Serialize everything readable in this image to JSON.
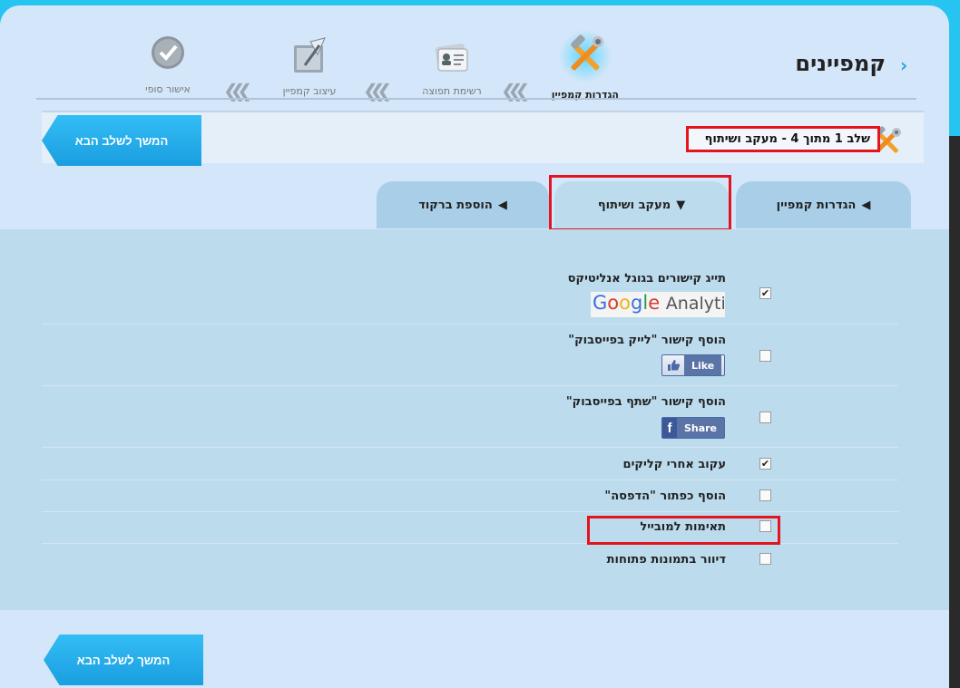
{
  "header": {
    "title": "קמפיינים"
  },
  "steps": [
    {
      "label": "הגדרות קמפיין",
      "icon": "tools-icon",
      "active": true
    },
    {
      "label": "רשימת תפוצה",
      "icon": "contacts-card-icon",
      "active": false
    },
    {
      "label": "עיצוב קמפיין",
      "icon": "design-pen-icon",
      "active": false
    },
    {
      "label": "אישור סופי",
      "icon": "checkmark-circle-icon",
      "active": false
    }
  ],
  "stepbar": {
    "info": "שלב 1 מתוך 4 - מעקב ושיתוף",
    "continue_label": "המשך לשלב הבא"
  },
  "tabs": [
    {
      "label": "הגדרות קמפיין",
      "state": "collapsed"
    },
    {
      "label": "מעקב ושיתוף",
      "state": "expanded"
    },
    {
      "label": "הוספת ברקוד",
      "state": "collapsed"
    }
  ],
  "options": [
    {
      "label": "תייג קישורים בגוגל אנליטיקס",
      "checked": true,
      "badge": "Google Analytics"
    },
    {
      "label": "הוסף קישור \"לייק בפייסבוק\"",
      "checked": false,
      "badge": "Like"
    },
    {
      "label": "הוסף קישור \"שתף בפייסבוק\"",
      "checked": false,
      "badge": "Share"
    },
    {
      "label": "עקוב אחרי קליקים",
      "checked": true
    },
    {
      "label": "הוסף כפתור \"הדפסה\"",
      "checked": false
    },
    {
      "label": "תאימות למובייל",
      "checked": false
    },
    {
      "label": "דיוור בתמונות פתוחות",
      "checked": false
    }
  ],
  "footer": {
    "continue_label": "המשך לשלב הבא"
  },
  "colors": {
    "accent": "#26c5f1",
    "highlight": "#e3141f",
    "button": "#1a9ee0"
  }
}
